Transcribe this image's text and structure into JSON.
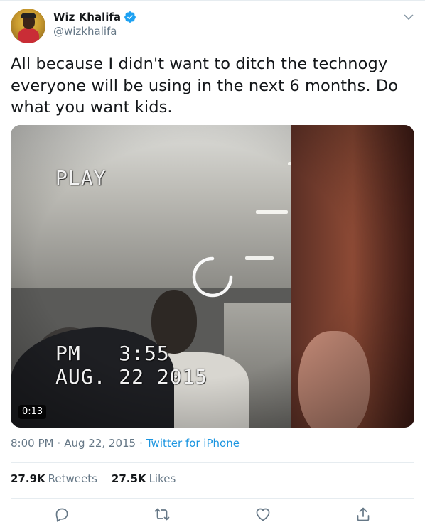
{
  "tweet": {
    "display_name": "Wiz Khalifa",
    "handle": "@wizkhalifa",
    "verified_icon": "verified-badge-icon",
    "menu_icon": "chevron-down-icon",
    "text": "All because I didn't want to ditch the technogy everyone will be using in the next 6 months. Do what you want kids.",
    "media": {
      "overlay_play": "PLAY",
      "overlay_time": "PM   3:55",
      "overlay_date": "AUG. 22 2015",
      "duration": "0:13",
      "loading_icon": "loading-spinner-icon"
    },
    "meta": {
      "time": "8:00 PM",
      "separator": "·",
      "date": "Aug 22, 2015",
      "source": "Twitter for iPhone"
    },
    "stats": {
      "retweets_count": "27.9K",
      "retweets_label": "Retweets",
      "likes_count": "27.5K",
      "likes_label": "Likes"
    },
    "actions": [
      "reply-icon",
      "retweet-icon",
      "like-icon",
      "share-icon"
    ]
  },
  "colors": {
    "text": "#14171a",
    "secondary": "#657786",
    "link": "#1b95e0",
    "verified": "#1da1f2",
    "divider": "#e6ecf0"
  }
}
